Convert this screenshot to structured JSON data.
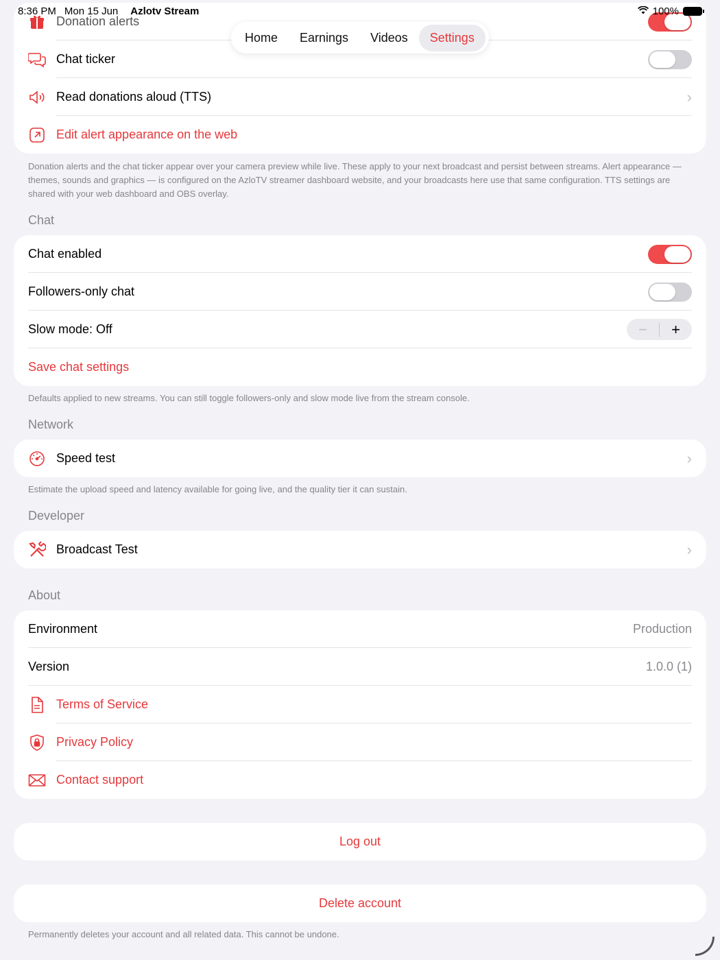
{
  "status_bar": {
    "time": "8:36 PM",
    "date": "Mon 15 Jun",
    "app_name": "Azlotv Stream",
    "battery": "100%"
  },
  "tabs": [
    {
      "label": "Home"
    },
    {
      "label": "Earnings"
    },
    {
      "label": "Videos"
    },
    {
      "label": "Settings",
      "active": true
    }
  ],
  "alerts": {
    "rows": [
      {
        "label": "Donation alerts",
        "icon": "gift-icon",
        "toggle": true
      },
      {
        "label": "Chat ticker",
        "icon": "chat-bubbles-icon",
        "toggle": false
      },
      {
        "label": "Read donations aloud (TTS)",
        "icon": "speaker-icon"
      },
      {
        "label": "Edit alert appearance on the web",
        "icon": "external-link-icon"
      }
    ],
    "footnote": "Donation alerts and the chat ticker appear over your camera preview while live. These apply to your next broadcast and persist between streams. Alert appearance — themes, sounds and graphics — is configured on the AzloTV streamer dashboard website, and your broadcasts here use that same configuration. TTS settings are shared with your web dashboard and OBS overlay."
  },
  "chat": {
    "header": "Chat",
    "chat_enabled": "Chat enabled",
    "chat_enabled_on": true,
    "followers_only": "Followers-only chat",
    "followers_only_on": false,
    "slow_mode": "Slow mode: Off",
    "stepper_minus": "−",
    "stepper_plus": "+",
    "save": "Save chat settings",
    "footnote": "Defaults applied to new streams. You can still toggle followers-only and slow mode live from the stream console."
  },
  "network": {
    "header": "Network",
    "speed_test": "Speed test",
    "footnote": "Estimate the upload speed and latency available for going live, and the quality tier it can sustain."
  },
  "developer": {
    "header": "Developer",
    "broadcast_test": "Broadcast Test"
  },
  "about": {
    "header": "About",
    "environment_label": "Environment",
    "environment_value": "Production",
    "version_label": "Version",
    "version_value": "1.0.0 (1)",
    "terms": "Terms of Service",
    "privacy": "Privacy Policy",
    "contact": "Contact support"
  },
  "account": {
    "logout": "Log out",
    "delete": "Delete account",
    "footnote": "Permanently deletes your account and all related data. This cannot be undone."
  },
  "colors": {
    "accent": "#e5383b",
    "background": "#f2f2f7",
    "toggle_on": "#f04a4c"
  }
}
